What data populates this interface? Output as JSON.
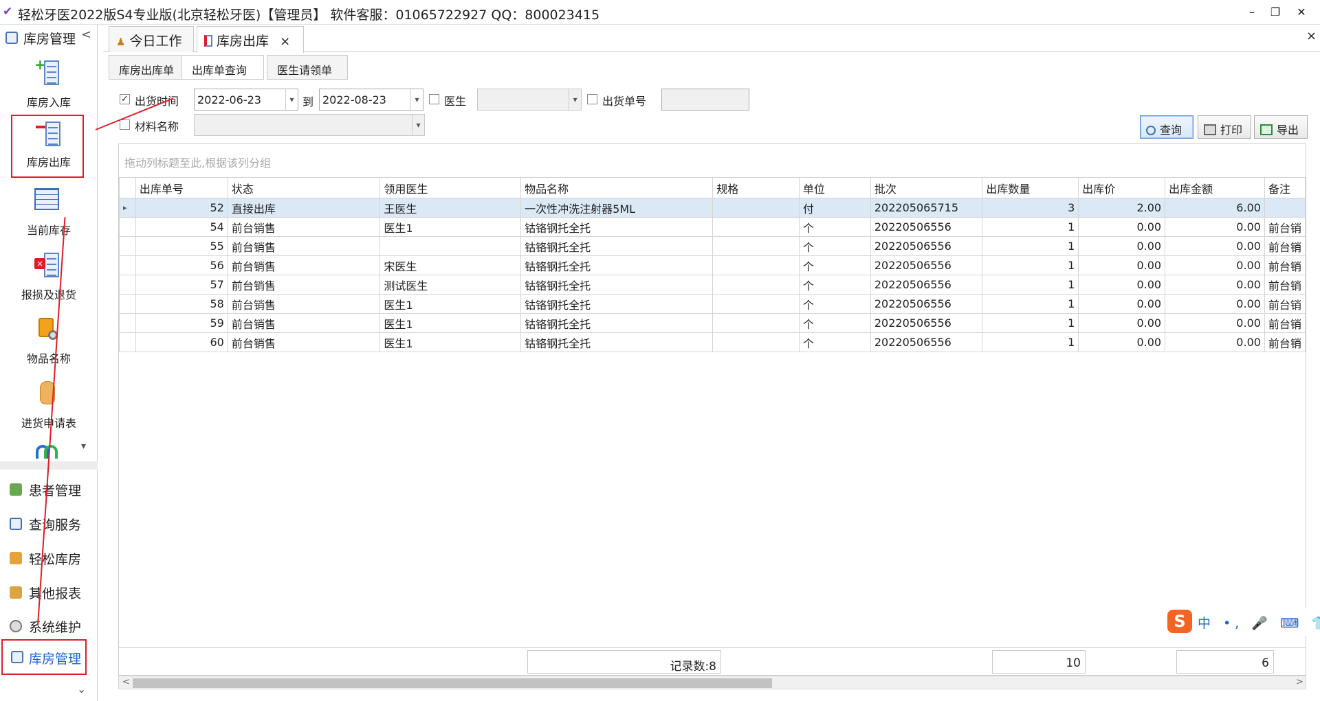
{
  "window": {
    "title": "轻松牙医2022版S4专业版(北京轻松牙医)【管理员】    软件客服：01065722927 QQ：800023415",
    "minimize": "–",
    "restore": "❐",
    "close": "✕"
  },
  "sidebar": {
    "header": "库房管理",
    "collapse": "<",
    "items": [
      {
        "label": "库房入库"
      },
      {
        "label": "库房出库"
      },
      {
        "label": "当前库存"
      },
      {
        "label": "报损及退货"
      },
      {
        "label": "物品名称"
      },
      {
        "label": "进货申请表"
      }
    ],
    "more": "▾",
    "nav": [
      {
        "label": "患者管理"
      },
      {
        "label": "查询服务"
      },
      {
        "label": "轻松库房"
      },
      {
        "label": "其他报表"
      },
      {
        "label": "系统维护"
      },
      {
        "label": "库房管理"
      }
    ],
    "down": "⌄"
  },
  "tabs": [
    {
      "label": "今日工作"
    },
    {
      "label": "库房出库",
      "close": "×"
    }
  ],
  "tabbar_close": "×",
  "subtabs": [
    {
      "label": "库房出库单"
    },
    {
      "label": "出库单查询"
    },
    {
      "label": "医生请领单"
    }
  ],
  "filters": {
    "ship_time_label": "出货时间",
    "ship_time_checked": true,
    "date_from": "2022-06-23",
    "to_label": "到",
    "date_to": "2022-08-23",
    "doctor_label": "医生",
    "order_no_label": "出货单号",
    "material_label": "材料名称"
  },
  "buttons": {
    "query": "查询",
    "print": "打印",
    "export": "导出"
  },
  "grid": {
    "group_hint": "拖动列标题至此,根据该列分组",
    "columns": [
      "出库单号",
      "状态",
      "领用医生",
      "物品名称",
      "规格",
      "单位",
      "批次",
      "出库数量",
      "出库价",
      "出库金额",
      "备注"
    ],
    "rows": [
      [
        "52",
        "直接出库",
        "王医生",
        "一次性冲洗注射器5ML",
        "",
        "付",
        "202205065715",
        "3",
        "2.00",
        "6.00",
        ""
      ],
      [
        "54",
        "前台销售",
        "医生1",
        "钴铬钢托全托",
        "",
        "个",
        "20220506556",
        "1",
        "0.00",
        "0.00",
        "前台销"
      ],
      [
        "55",
        "前台销售",
        "",
        "钴铬钢托全托",
        "",
        "个",
        "20220506556",
        "1",
        "0.00",
        "0.00",
        "前台销"
      ],
      [
        "56",
        "前台销售",
        "宋医生",
        "钴铬钢托全托",
        "",
        "个",
        "20220506556",
        "1",
        "0.00",
        "0.00",
        "前台销"
      ],
      [
        "57",
        "前台销售",
        "测试医生",
        "钴铬钢托全托",
        "",
        "个",
        "20220506556",
        "1",
        "0.00",
        "0.00",
        "前台销"
      ],
      [
        "58",
        "前台销售",
        "医生1",
        "钴铬钢托全托",
        "",
        "个",
        "20220506556",
        "1",
        "0.00",
        "0.00",
        "前台销"
      ],
      [
        "59",
        "前台销售",
        "医生1",
        "钴铬钢托全托",
        "",
        "个",
        "20220506556",
        "1",
        "0.00",
        "0.00",
        "前台销"
      ],
      [
        "60",
        "前台销售",
        "医生1",
        "钴铬钢托全托",
        "",
        "个",
        "20220506556",
        "1",
        "0.00",
        "0.00",
        "前台销"
      ]
    ],
    "footer": {
      "record_count": "记录数:8",
      "qty_total": "10",
      "amount_total": "6"
    },
    "row_indicator": "▸"
  },
  "ime": {
    "logo": "S",
    "items": "中 •, 🎤 ⌨ 👕 ⊞"
  },
  "colors": {
    "highlight": "#e21c24",
    "selected_row": "#dbe9f7"
  }
}
